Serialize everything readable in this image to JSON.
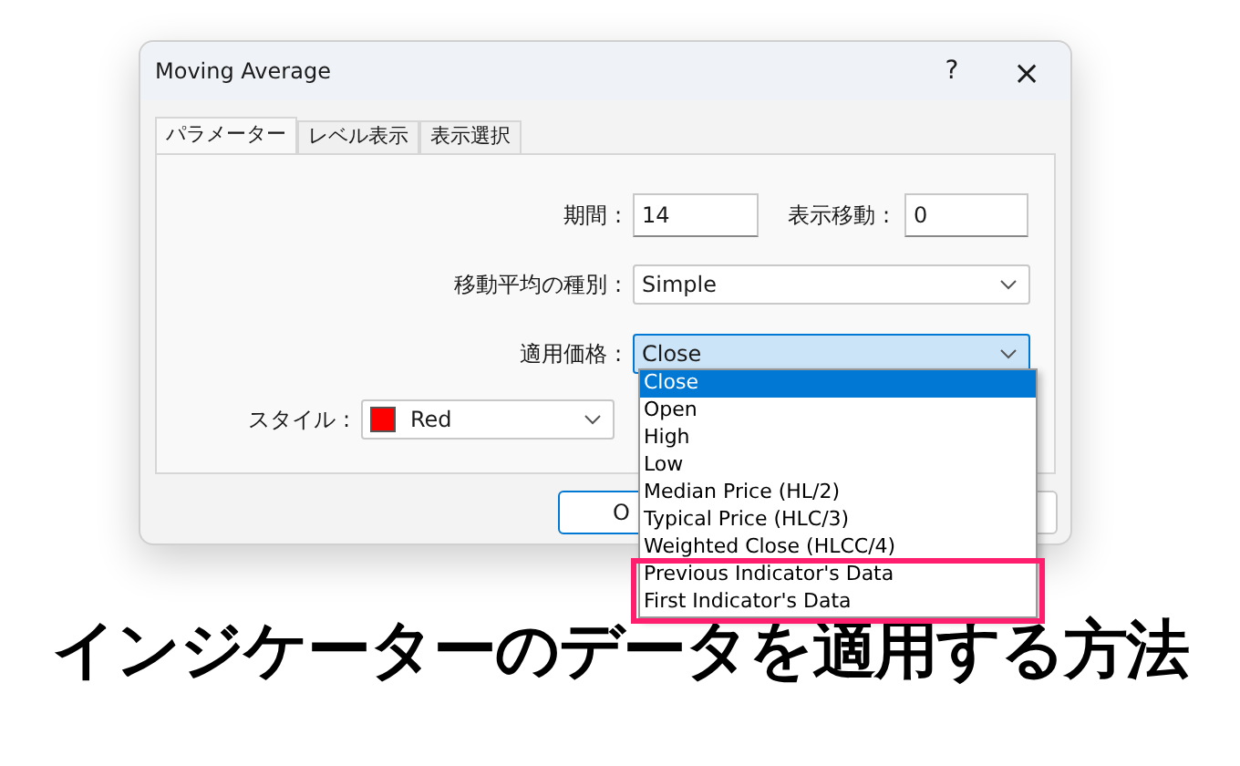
{
  "window": {
    "title": "Moving Average",
    "help": "?",
    "close": "×"
  },
  "tabs": [
    {
      "label": "パラメーター",
      "selected": true
    },
    {
      "label": "レベル表示",
      "selected": false
    },
    {
      "label": "表示選択",
      "selected": false
    }
  ],
  "fields": {
    "period": {
      "label": "期間 :",
      "value": "14"
    },
    "shift": {
      "label": "表示移動 :",
      "value": "0"
    },
    "method": {
      "label": "移動平均の種別 :",
      "value": "Simple"
    },
    "apply_to": {
      "label": "適用価格 :",
      "value": "Close",
      "expanded": true
    },
    "style": {
      "label": "スタイル :",
      "value": "Red",
      "color": "#ff0000"
    }
  },
  "buttons": [
    {
      "label": "O"
    }
  ],
  "dropdown": [
    {
      "label": "Close",
      "selected": true,
      "highlighted": false
    },
    {
      "label": "Open",
      "selected": false,
      "highlighted": false
    },
    {
      "label": "High",
      "selected": false,
      "highlighted": false
    },
    {
      "label": "Low",
      "selected": false,
      "highlighted": false
    },
    {
      "label": "Median Price (HL/2)",
      "selected": false,
      "highlighted": false
    },
    {
      "label": "Typical Price (HLC/3)",
      "selected": false,
      "highlighted": false
    },
    {
      "label": "Weighted Close (HLCC/4)",
      "selected": false,
      "highlighted": false
    },
    {
      "label": "Previous Indicator's Data",
      "selected": false,
      "highlighted": true
    },
    {
      "label": "First Indicator's Data",
      "selected": false,
      "highlighted": true
    }
  ],
  "headline": "インジケーターのデータを適用する方法"
}
